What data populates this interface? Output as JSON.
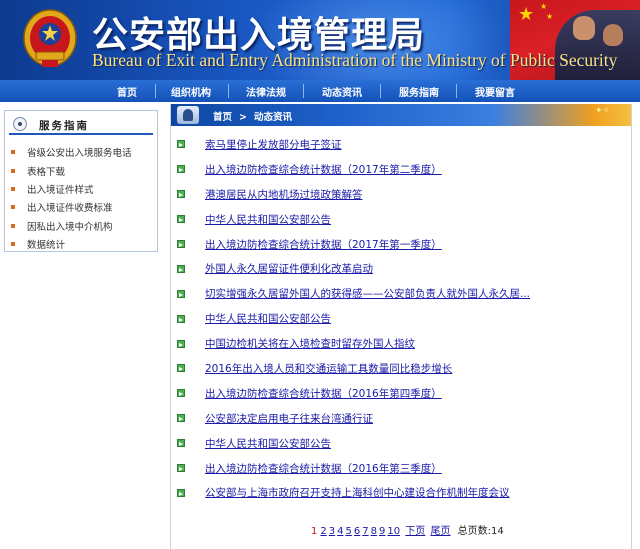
{
  "header": {
    "title_cn": "公安部出入境管理局",
    "title_en": "Bureau of Exit and Entry Administration of the Ministry of Public Security"
  },
  "nav": {
    "items": [
      "首页",
      "组织机构",
      "法律法规",
      "动态资讯",
      "服务指南",
      "我要留言"
    ]
  },
  "sidebar": {
    "title": "服务指南",
    "items": [
      "省级公安出入境服务电话",
      "表格下载",
      "出入境证件样式",
      "出入境证件收费标准",
      "因私出入境中介机构",
      "数据统计"
    ]
  },
  "breadcrumb": {
    "home": "首页",
    "separator": ">",
    "current": "动态资讯"
  },
  "news": [
    "索马里停止发放部分电子签证",
    "出入境边防检查综合统计数据（2017年第二季度）",
    "港澳居民从内地机场过境政策解答",
    "中华人民共和国公安部公告",
    "出入境边防检查综合统计数据（2017年第一季度）",
    "外国人永久居留证件便利化改革启动",
    "切实增强永久居留外国人的获得感——公安部负责人就外国人永久居...",
    "中华人民共和国公安部公告",
    "中国边检机关将在入境检查时留存外国人指纹",
    "2016年出入境人员和交通运输工具数量同比稳步增长",
    "出入境边防检查综合统计数据（2016年第四季度）",
    "公安部决定启用电子往来台湾通行证",
    "中华人民共和国公安部公告",
    "出入境边防检查综合统计数据（2016年第三季度）",
    "公安部与上海市政府召开支持上海科创中心建设合作机制年度会议"
  ],
  "pager": {
    "current": "1",
    "pages": [
      "2",
      "3",
      "4",
      "5",
      "6",
      "7",
      "8",
      "9",
      "10"
    ],
    "next": "下页",
    "last": "尾页",
    "total_label": "总页数:14"
  },
  "colors": {
    "banner_blue": "#1a58c4",
    "nav_blue": "#1452b8",
    "link_blue": "#1a1aa8",
    "flag_red": "#d92026",
    "title_en_gold": "#ffe27a",
    "list_dot_orange": "#d96a1a",
    "news_icon_green": "#4caf50"
  },
  "icons": {
    "emblem": "national-police-emblem-icon",
    "sidebar_head": "circle-bullet-icon",
    "breadcrumb": "police-badge-icon",
    "news_item": "green-arrow-icon",
    "sidebar_item": "orange-square-bullet-icon"
  }
}
